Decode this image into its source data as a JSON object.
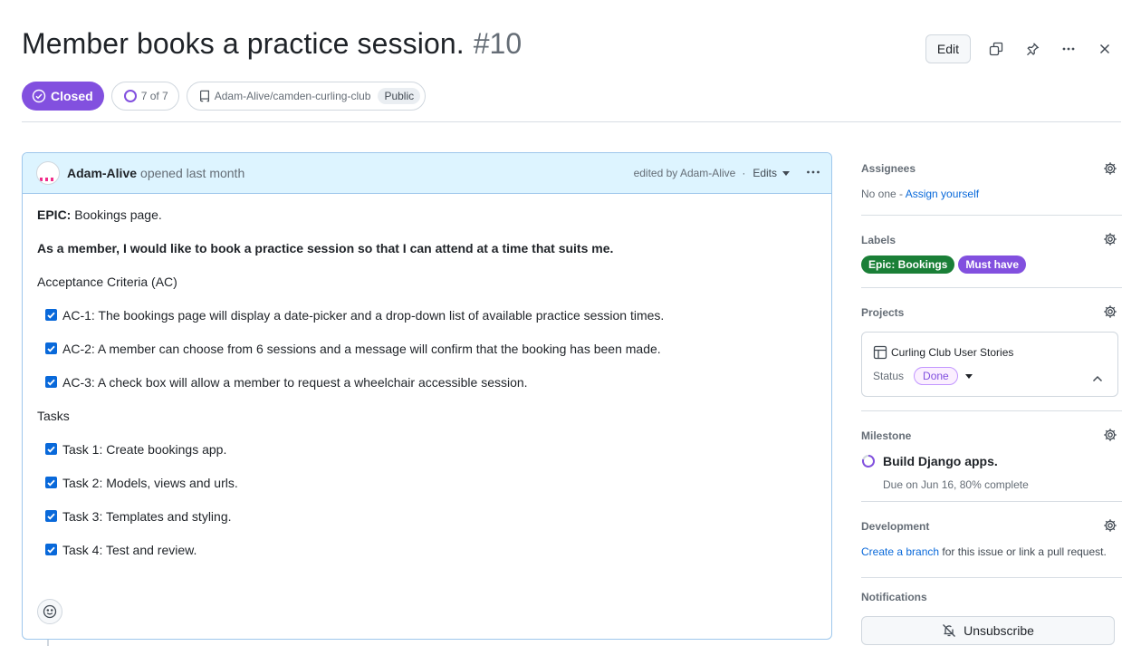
{
  "issue": {
    "title": "Member books a practice session.",
    "number": "#10",
    "state": "Closed",
    "subissues": "7 of 7",
    "repo": "Adam-Alive/camden-curling-club",
    "visibility": "Public"
  },
  "header": {
    "edit_label": "Edit"
  },
  "comment": {
    "author": "Adam-Alive",
    "opened": "opened last month",
    "edited_by": "edited by Adam-Alive",
    "separator": "·",
    "edits_label": "Edits",
    "epic_prefix": "EPIC:",
    "epic_text": " Bookings page.",
    "story": "As a member, I would like to book a practice session so that I can attend at a time that suits me.",
    "ac_heading": "Acceptance Criteria (AC)",
    "ac_items": [
      "AC-1: The bookings page will display a date-picker and a drop-down list of available practice session times.",
      "AC-2: A member can choose from 6 sessions and a message will confirm that the booking has been made.",
      "AC-3: A check box will allow a member to request a wheelchair accessible session."
    ],
    "tasks_heading": "Tasks",
    "tasks": [
      "Task 1: Create bookings app.",
      "Task 2: Models, views and urls.",
      "Task 3: Templates and styling.",
      "Task 4: Test and review."
    ]
  },
  "sidebar": {
    "assignees": {
      "title": "Assignees",
      "none": "No one - ",
      "assign_link": "Assign yourself"
    },
    "labels": {
      "title": "Labels",
      "items": [
        {
          "name": "Epic: Bookings",
          "color": "#1a7f37"
        },
        {
          "name": "Must have",
          "color": "#8250df"
        }
      ]
    },
    "projects": {
      "title": "Projects",
      "project_name": "Curling Club User Stories",
      "status_label": "Status",
      "status_value": "Done"
    },
    "milestone": {
      "title": "Milestone",
      "name": "Build Django apps.",
      "due": "Due on Jun 16, 80% complete"
    },
    "development": {
      "title": "Development",
      "link": "Create a branch",
      "text": " for this issue or link a pull request."
    },
    "notifications": {
      "title": "Notifications",
      "button": "Unsubscribe"
    }
  },
  "colors": {
    "closed_purple": "#8250df",
    "link_blue": "#0969da",
    "comment_header_bg": "#ddf4ff"
  }
}
